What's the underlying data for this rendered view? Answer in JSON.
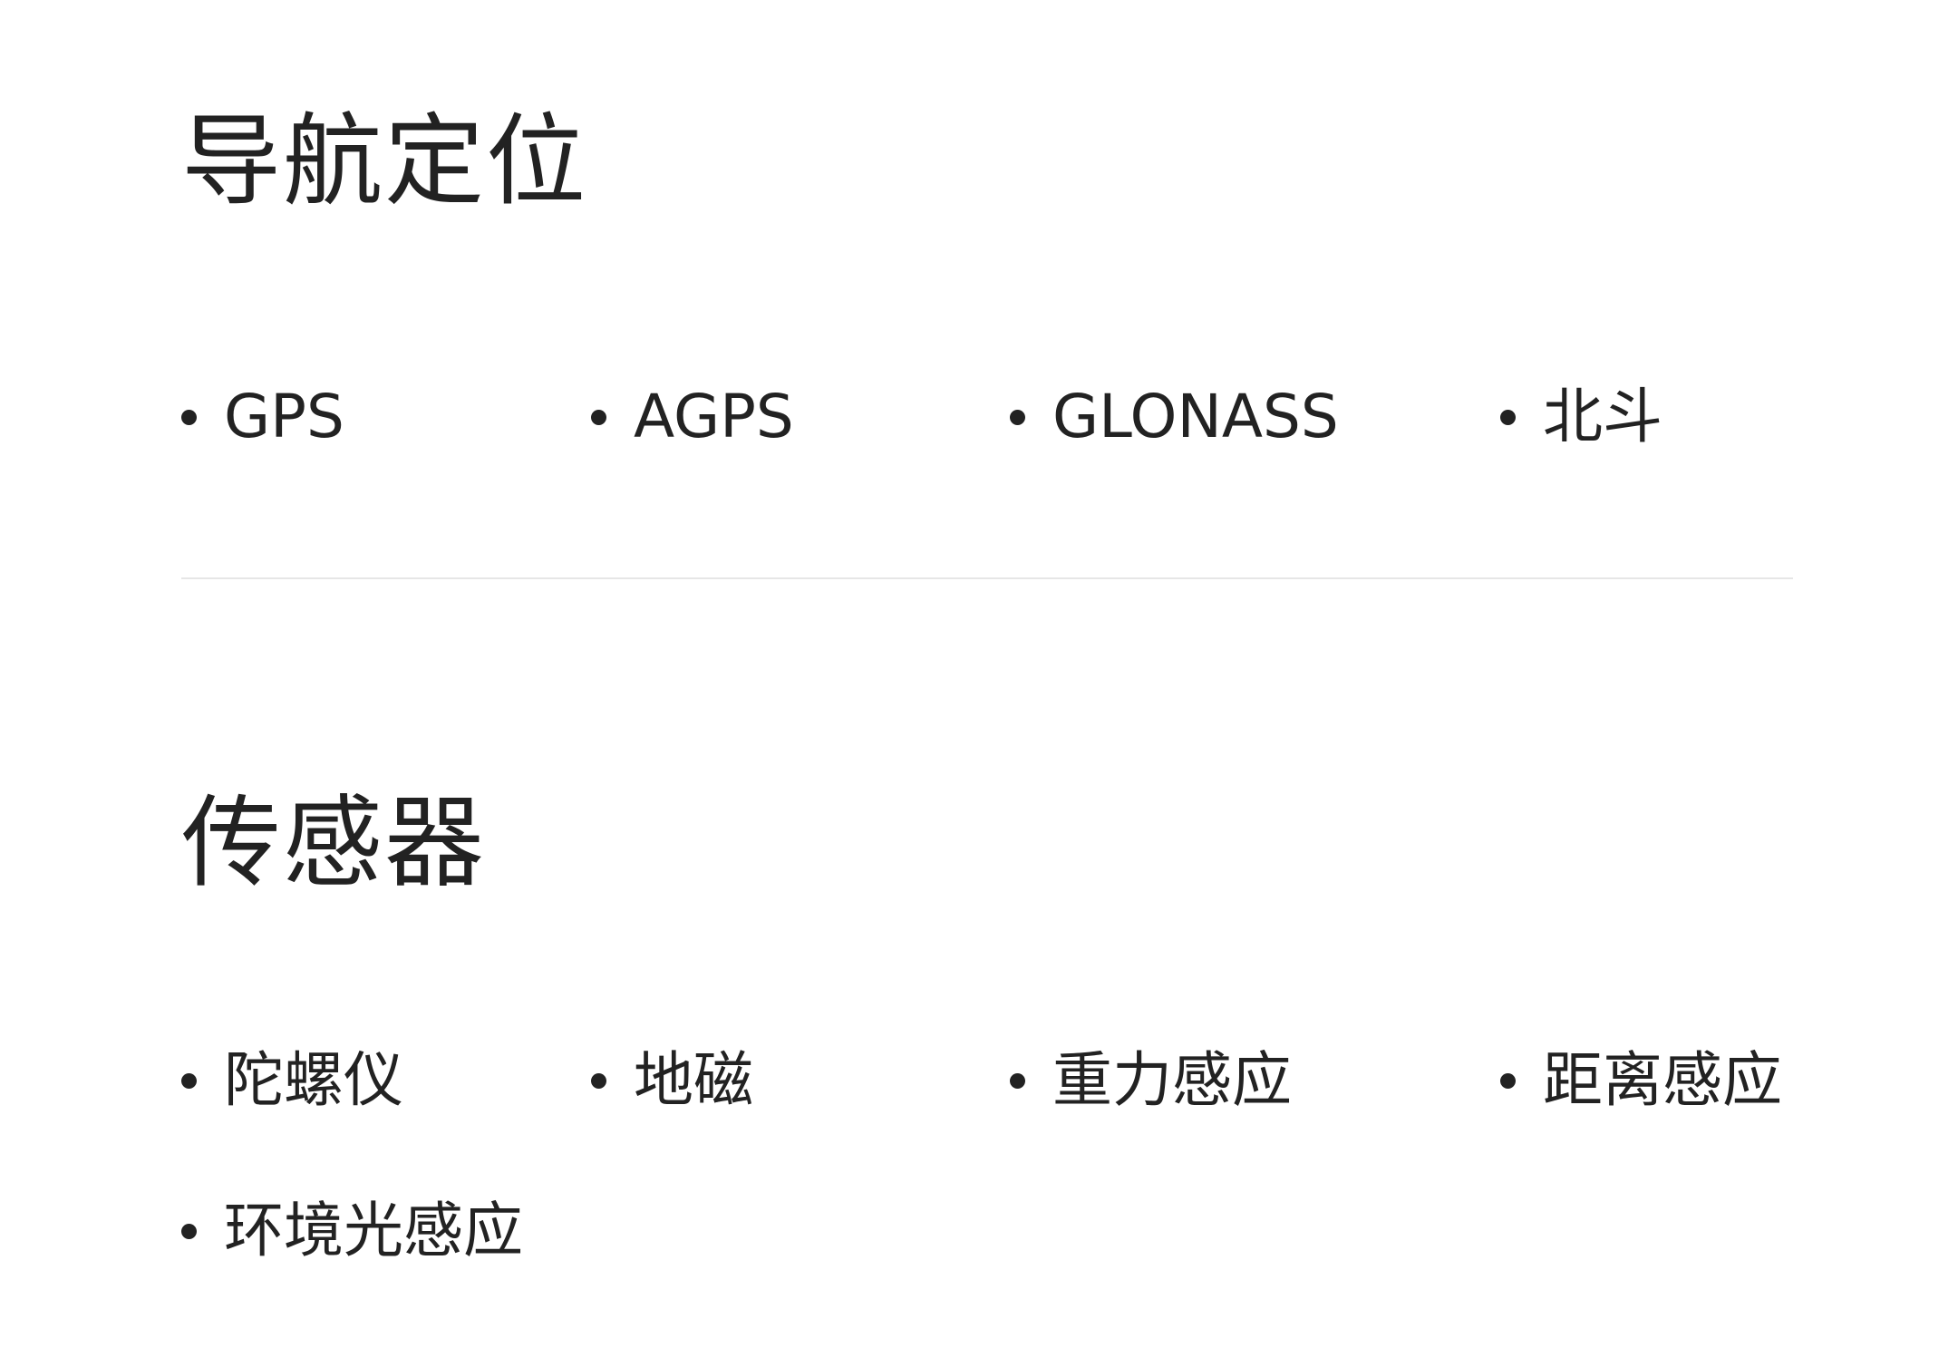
{
  "navigation": {
    "title": "导航定位",
    "items": [
      "GPS",
      "AGPS",
      "GLONASS",
      "北斗"
    ]
  },
  "sensors": {
    "title": "传感器",
    "items": [
      "陀螺仪",
      "地磁",
      "重力感应",
      "距离感应",
      "环境光感应"
    ]
  }
}
